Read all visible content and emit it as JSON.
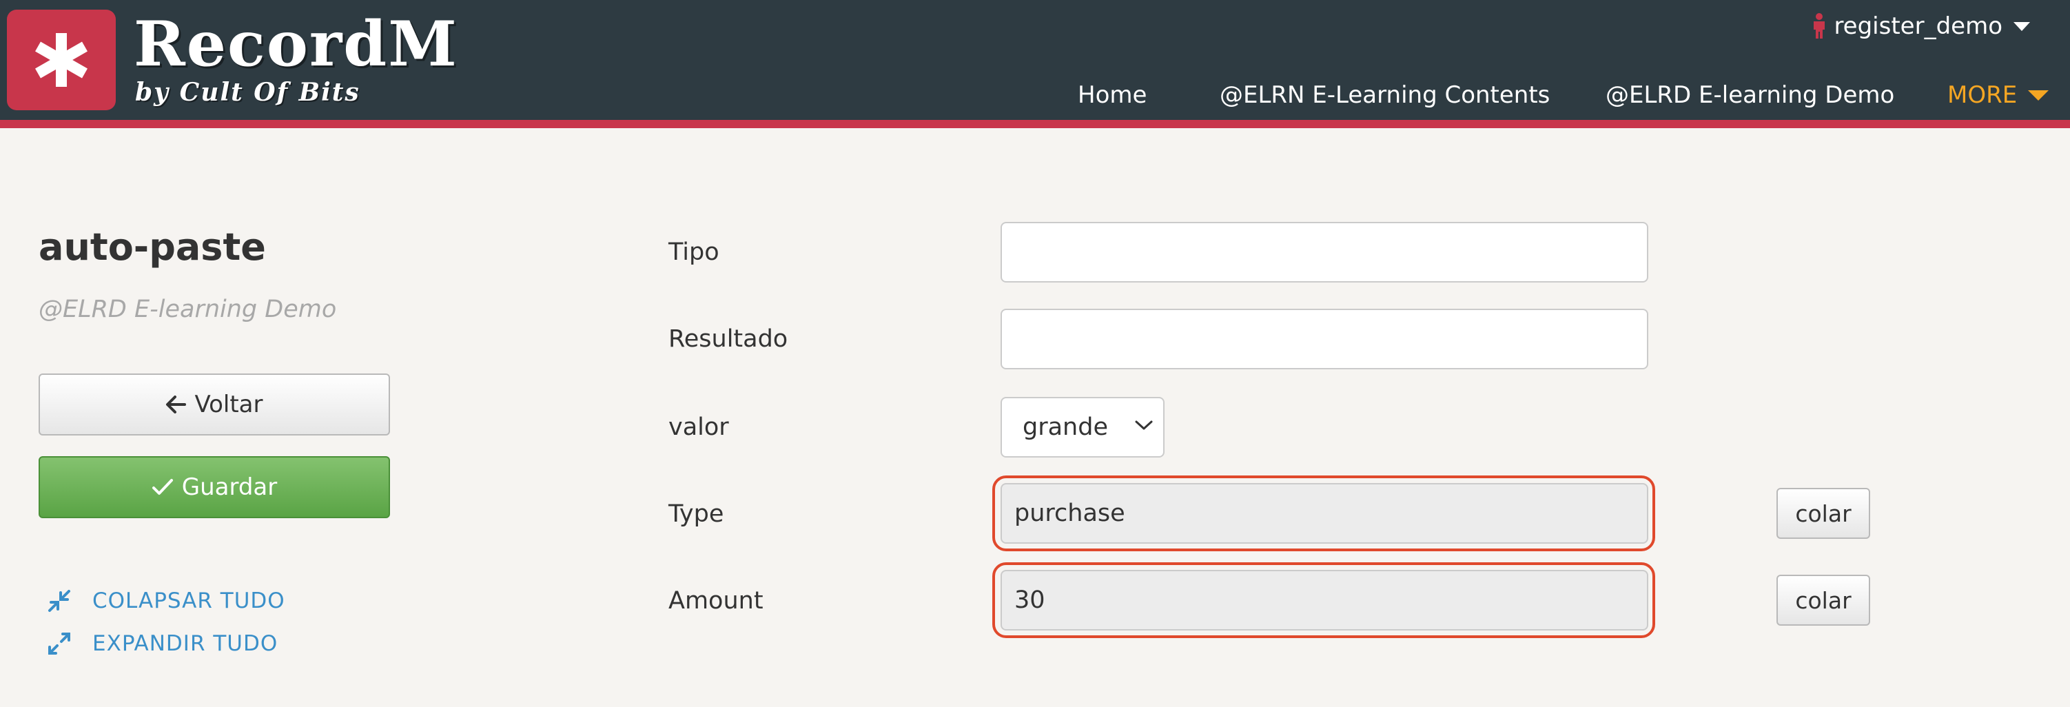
{
  "brand": {
    "name": "RecordM",
    "subtitle": "by Cult Of Bits",
    "accent_color": "#c8364b",
    "header_color": "#2e3b42"
  },
  "user_menu": {
    "username": "register_demo",
    "icon": "person-icon"
  },
  "nav": {
    "items": [
      "Home",
      "@ELRN E-Learning Contents",
      "@ELRD E-learning Demo"
    ],
    "more_label": "MORE",
    "more_color": "#f5a623"
  },
  "left_panel": {
    "title": "auto-paste",
    "subtitle": "@ELRD E-learning Demo",
    "back_label": "Voltar",
    "save_label": "Guardar",
    "collapse_label": "COLAPSAR TUDO",
    "expand_label": "EXPANDIR TUDO"
  },
  "form": {
    "fields": [
      {
        "label": "Tipo",
        "value": ""
      },
      {
        "label": "Resultado",
        "value": ""
      },
      {
        "label": "valor",
        "value": "grande"
      },
      {
        "label": "Type",
        "value": "purchase",
        "action": "colar"
      },
      {
        "label": "Amount",
        "value": "30",
        "action": "colar"
      }
    ],
    "highlight_color": "#e0492c"
  }
}
